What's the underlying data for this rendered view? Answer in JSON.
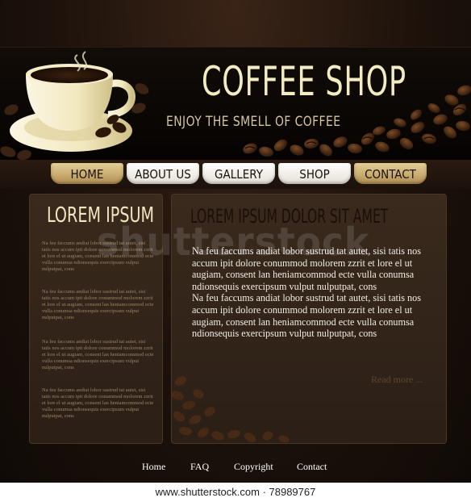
{
  "header": {
    "title": "COFFEE SHOP",
    "tagline": "ENJOY THE SMELL OF COFFEE"
  },
  "nav": {
    "home": "HOME",
    "about": "ABOUT US",
    "gallery": "GALLERY",
    "shop": "SHOP",
    "contact": "CONTACT"
  },
  "sidebar": {
    "heading": "LOREM IPSUM",
    "paragraphs": [
      "Na feu faccums andiat lobor sustrud tat autet, sisi tatis nos accum ipit dolore conummod molorem zzrit et lore el ut augiam, consent lan heniamcommod ecte vulla conumsa ndionsequis exercipsum vulput nulputpat, cons",
      "Na feu faccums andiat lobor sustrud tat autet, sisi tatis nos accum ipit dolore conummod molorem zzrit et lore el ut augiam, consent lan heniamcommod ecte vulla conumsa ndionsequis exercipsum vulput nulputpat, cons",
      "Na feu faccums andiat lobor sustrud tat autet, sisi tatis nos accum ipit dolore conummod molorem zzrit et lore el ut augiam, consent lan heniamcommod ecte vulla conumsa ndionsequis exercipsum vulput nulputpat, cons",
      "Na feu faccums andiat lobor sustrud tat autet, sisi tatis nos accum ipit dolore conummod molorem zzrit et lore el ut augiam, consent lan heniamcommod ecte vulla conumsa ndionsequis exercipsum vulput nulputpat, cons"
    ]
  },
  "main": {
    "heading": "LOREM IPSUM DOLOR SIT AMET",
    "paragraphs": [
      "Na feu faccums andiat lobor sustrud tat autet, sisi tatis nos accum ipit dolore conummod molorem zzrit et lore el ut augiam, consent lan heniamcommod ecte vulla conumsa ndionsequis exercipsum vulput nulputpat, cons",
      "Na feu faccums andiat lobor sustrud tat autet, sisi tatis nos accum ipit dolore conummod molorem zzrit et lore el ut augiam, consent lan heniamcommod ecte vulla conumsa ndionsequis exercipsum vulput nulputpat, cons"
    ],
    "read_more": "Read more ..."
  },
  "footer": {
    "home": "Home",
    "faq": "FAQ",
    "copyright": "Copyright",
    "contact": "Contact"
  },
  "watermark": "shutterstock",
  "stock_strip": "www.shutterstock.com · 78989767",
  "colors": {
    "background": "#1d120b",
    "gold": "#d4bb7e",
    "cream": "#f3ecc2",
    "panel": "#33251a"
  }
}
